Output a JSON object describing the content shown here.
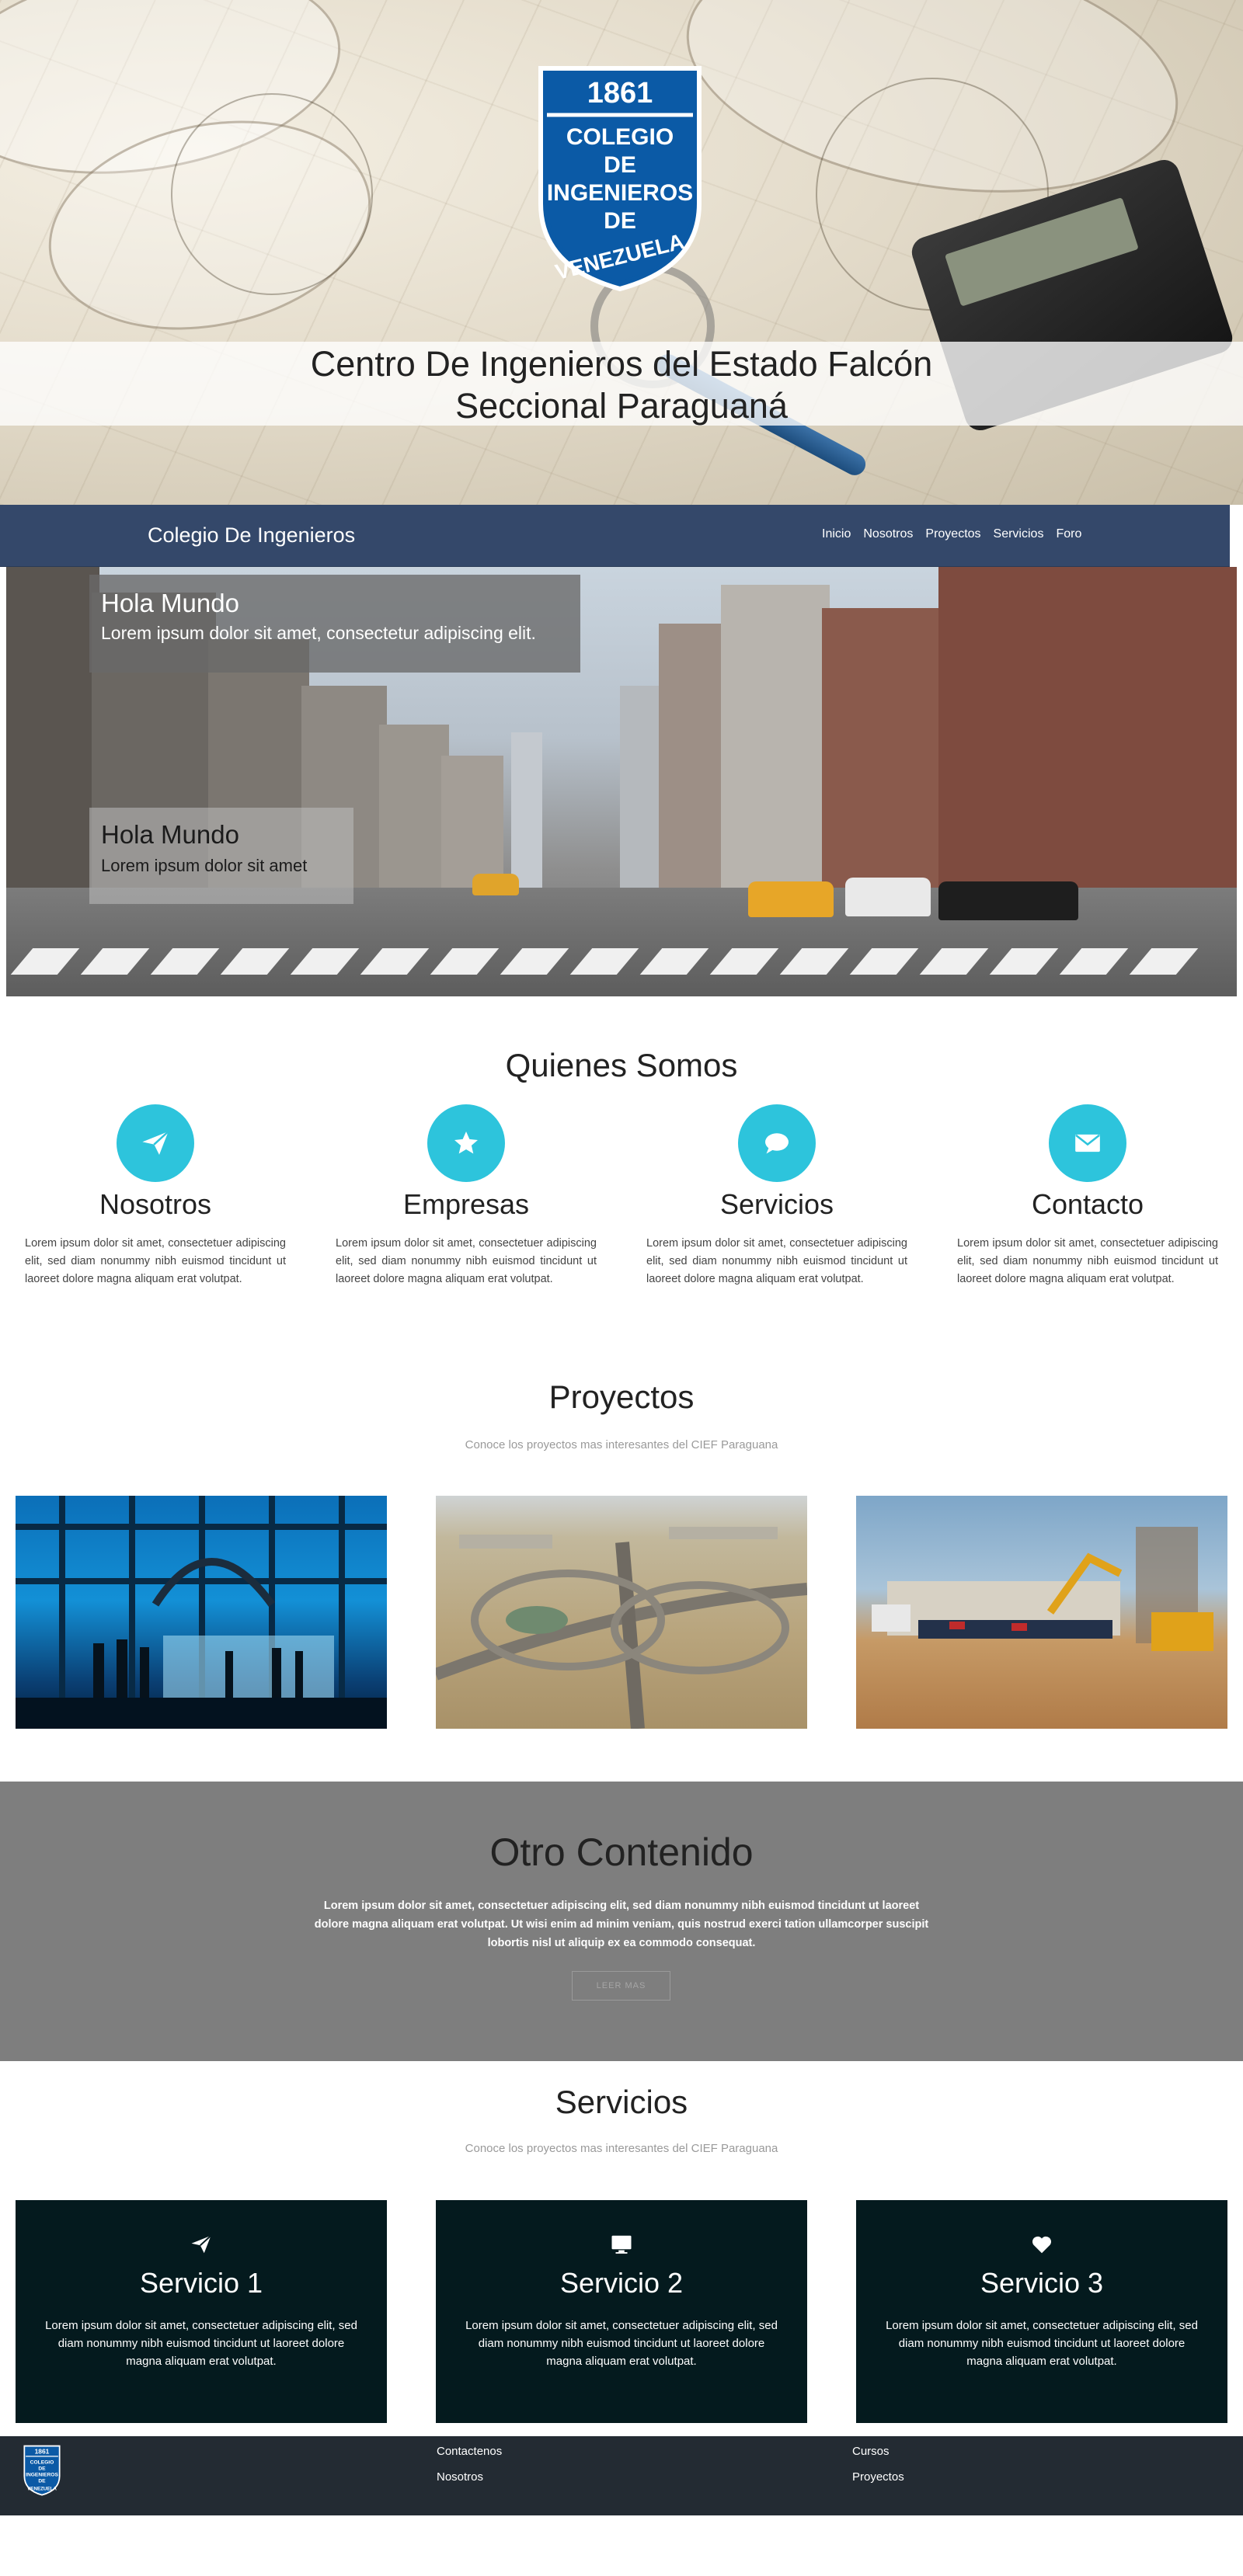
{
  "logo": {
    "year": "1861",
    "line1": "COLEGIO",
    "line2": "DE",
    "line3": "INGENIEROS",
    "line4": "DE",
    "line5": "VENEZUELA"
  },
  "hero": {
    "title_line1": "Centro De Ingenieros del Estado Falcón",
    "title_line2": "Seccional Paraguaná"
  },
  "navbar": {
    "brand": "Colegio De Ingenieros",
    "links": [
      "Inicio",
      "Nosotros",
      "Proyectos",
      "Servicios",
      "Foro"
    ]
  },
  "carousel": {
    "captions": [
      {
        "title": "Hola Mundo",
        "text": "Lorem ipsum dolor sit amet, consectetur adipiscing elit."
      },
      {
        "title": "Hola Mundo",
        "text": "Lorem ipsum dolor sit amet"
      }
    ]
  },
  "about": {
    "title": "Quienes Somos",
    "features": [
      {
        "icon": "paper-plane-icon",
        "title": "Nosotros",
        "text": "Lorem ipsum dolor sit amet, consectetuer adipiscing elit, sed diam nonummy nibh euismod tincidunt ut laoreet dolore magna aliquam erat volutpat."
      },
      {
        "icon": "star-icon",
        "title": "Empresas",
        "text": "Lorem ipsum dolor sit amet, consectetuer adipiscing elit, sed diam nonummy nibh euismod tincidunt ut laoreet dolore magna aliquam erat volutpat."
      },
      {
        "icon": "chat-bubble-icon",
        "title": "Servicios",
        "text": "Lorem ipsum dolor sit amet, consectetuer adipiscing elit, sed diam nonummy nibh euismod tincidunt ut laoreet dolore magna aliquam erat volutpat."
      },
      {
        "icon": "envelope-icon",
        "title": "Contacto",
        "text": "Lorem ipsum dolor sit amet, consectetuer adipiscing elit, sed diam nonummy nibh euismod tincidunt ut laoreet dolore magna aliquam erat volutpat."
      }
    ],
    "accent_color": "#2dc4dc"
  },
  "projects": {
    "title": "Proyectos",
    "subtitle": "Conoce los proyectos mas interesantes del CIEF Paraguana"
  },
  "other": {
    "title": "Otro Contenido",
    "text": "Lorem ipsum dolor sit amet, consectetuer adipiscing elit, sed diam nonummy nibh euismod tincidunt ut laoreet dolore magna aliquam erat volutpat. Ut wisi enim ad minim veniam, quis nostrud exerci tation ullamcorper suscipit lobortis nisl ut aliquip ex ea commodo consequat.",
    "button": "LEER MAS"
  },
  "services": {
    "title": "Servicios",
    "subtitle": "Conoce los proyectos mas interesantes del CIEF Paraguana",
    "items": [
      {
        "icon": "paper-plane-icon",
        "title": "Servicio 1",
        "text": "Lorem ipsum dolor sit amet, consectetuer adipiscing elit, sed diam nonummy nibh euismod tincidunt ut laoreet dolore magna aliquam erat volutpat."
      },
      {
        "icon": "monitor-icon",
        "title": "Servicio 2",
        "text": "Lorem ipsum dolor sit amet, consectetuer adipiscing elit, sed diam nonummy nibh euismod tincidunt ut laoreet dolore magna aliquam erat volutpat."
      },
      {
        "icon": "heart-icon",
        "title": "Servicio 3",
        "text": "Lorem ipsum dolor sit amet, consectetuer adipiscing elit, sed diam nonummy nibh euismod tincidunt ut laoreet dolore magna aliquam erat volutpat."
      }
    ]
  },
  "footer": {
    "links": [
      "Contactenos",
      "Nosotros",
      "Cursos",
      "Proyectos"
    ]
  },
  "colors": {
    "navbar": "#34486a",
    "service_card": "#041a1e",
    "footer": "#232b33",
    "other_section": "#7e7e7e",
    "logo_blue": "#0b5aa6"
  }
}
